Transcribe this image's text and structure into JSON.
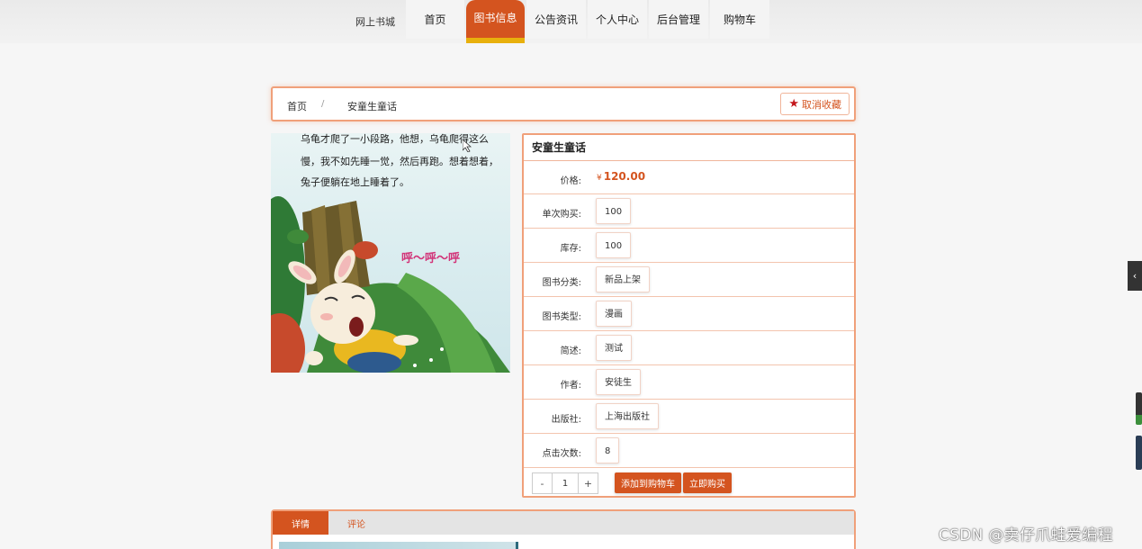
{
  "nav": {
    "brand": "网上书城",
    "items": [
      "首页",
      "图书信息",
      "公告资讯",
      "个人中心",
      "后台管理",
      "购物车"
    ],
    "active_index": 1
  },
  "breadcrumb": {
    "home": "首页",
    "separator": "/",
    "current": "安童生童话",
    "favorite_label": "取消收藏"
  },
  "book": {
    "title": "安童生童话",
    "image_text": {
      "line1": "乌龟才爬了一小段路，他想，乌龟爬得这么",
      "line2": "慢，我不如先睡一觉，然后再跑。想着想着，",
      "line3": "兔子便躺在地上睡着了。",
      "snore": "呼～呼～呼"
    },
    "price_label": "价格:",
    "price_currency": "¥",
    "price_value": "120.00",
    "fields": [
      {
        "label": "单次购买:",
        "value": "100"
      },
      {
        "label": "库存:",
        "value": "100"
      },
      {
        "label": "图书分类:",
        "value": "新品上架"
      },
      {
        "label": "图书类型:",
        "value": "漫画"
      },
      {
        "label": "简述:",
        "value": "测试"
      },
      {
        "label": "作者:",
        "value": "安徒生"
      },
      {
        "label": "出版社:",
        "value": "上海出版社"
      },
      {
        "label": "点击次数:",
        "value": "8"
      }
    ],
    "qty": {
      "minus": "-",
      "value": "1",
      "plus": "+"
    },
    "add_to_cart": "添加到购物车",
    "buy_now": "立即购买"
  },
  "tabs": {
    "items": [
      "详情",
      "评论"
    ],
    "active_index": 0
  },
  "side": {
    "toggle": "‹"
  },
  "watermark": "CSDN @卖仔爪蛙爱编程",
  "colors": {
    "accent": "#d4541f",
    "highlight": "#e8b00d",
    "border": "#f0a07a"
  }
}
